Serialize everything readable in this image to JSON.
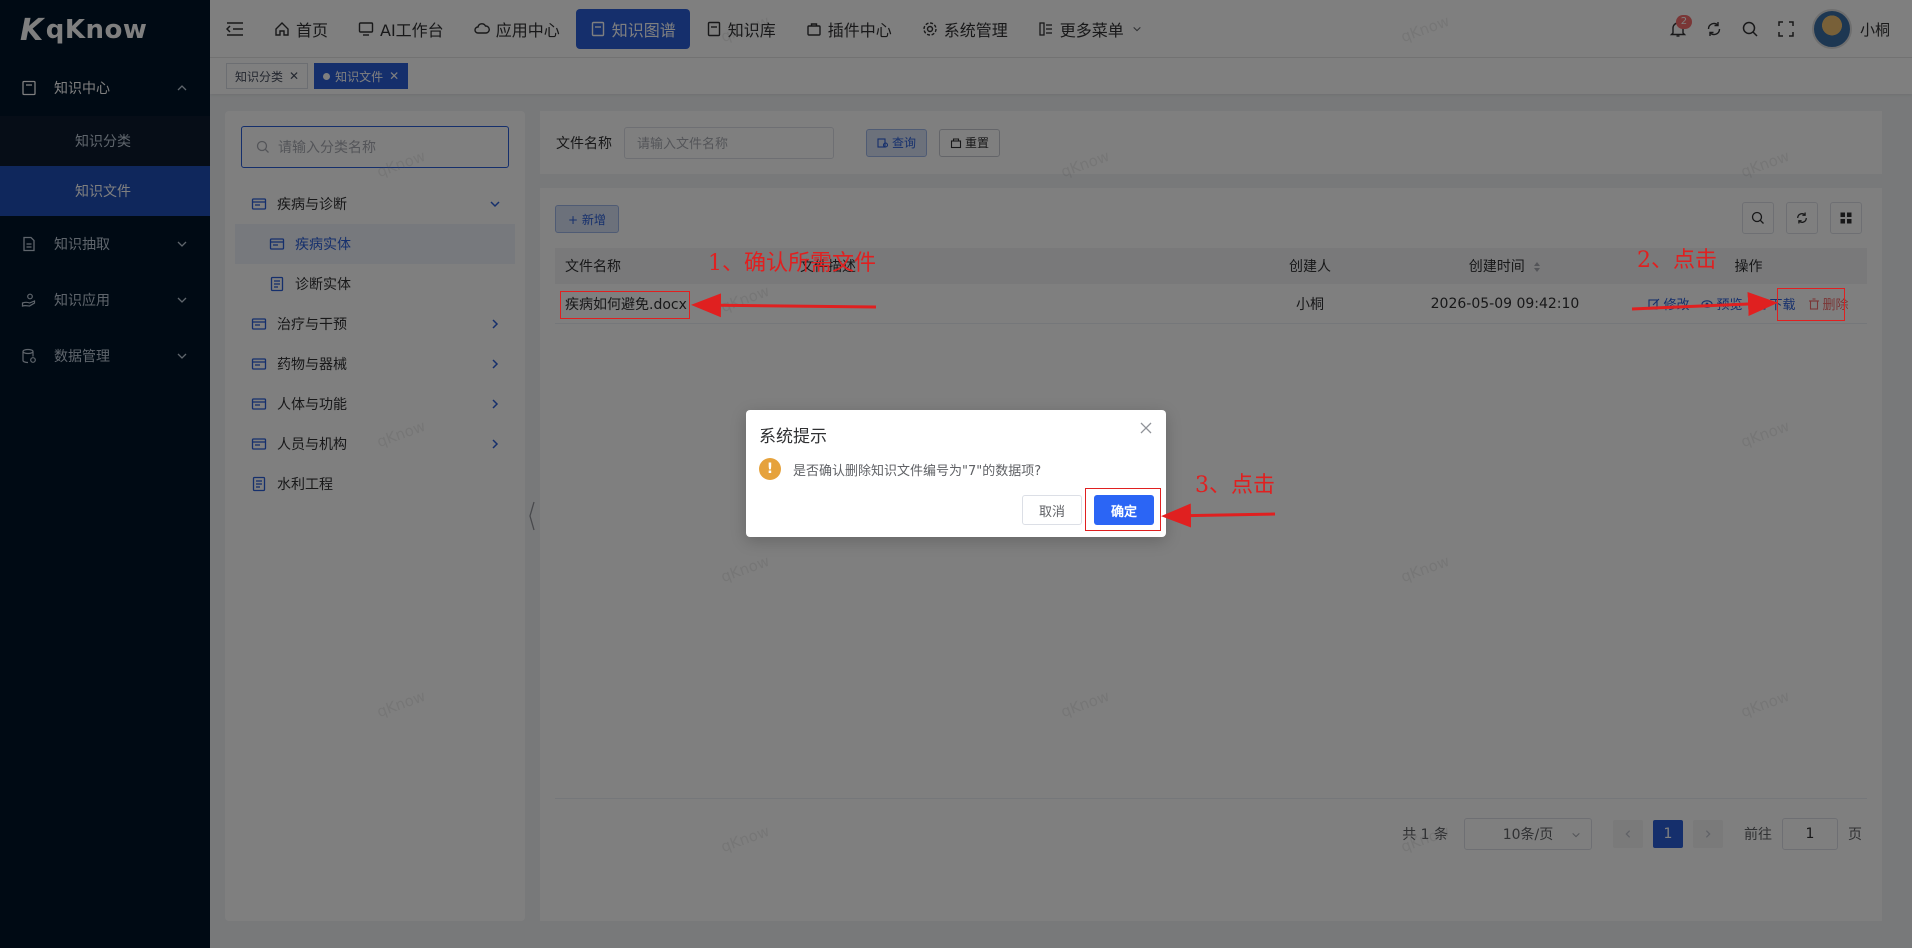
{
  "app": {
    "logo": "qKnow",
    "logo_mark": "K"
  },
  "sidebar": {
    "groups": [
      {
        "label": "知识中心",
        "expanded": true,
        "children": [
          {
            "label": "知识分类",
            "active": false
          },
          {
            "label": "知识文件",
            "active": true
          }
        ]
      },
      {
        "label": "知识抽取",
        "expanded": false
      },
      {
        "label": "知识应用",
        "expanded": false
      },
      {
        "label": "数据管理",
        "expanded": false
      }
    ]
  },
  "topnav": {
    "items": [
      {
        "label": "首页",
        "icon": "home-icon"
      },
      {
        "label": "AI工作台",
        "icon": "monitor-icon"
      },
      {
        "label": "应用中心",
        "icon": "cloud-icon"
      },
      {
        "label": "知识图谱",
        "icon": "document-icon",
        "active": true
      },
      {
        "label": "知识库",
        "icon": "book-icon"
      },
      {
        "label": "插件中心",
        "icon": "plugin-icon"
      },
      {
        "label": "系统管理",
        "icon": "gear-icon"
      },
      {
        "label": "更多菜单",
        "icon": "grid-menu-icon"
      }
    ],
    "notification_count": "2",
    "username": "小桐"
  },
  "tags": [
    {
      "label": "知识分类",
      "active": false
    },
    {
      "label": "知识文件",
      "active": true
    }
  ],
  "tree": {
    "search_placeholder": "请输入分类名称",
    "nodes": [
      {
        "label": "疾病与诊断",
        "expanded": true
      },
      {
        "label": "疾病实体",
        "child": true,
        "selected": true
      },
      {
        "label": "诊断实体",
        "child": true
      },
      {
        "label": "治疗与干预"
      },
      {
        "label": "药物与器械"
      },
      {
        "label": "人体与功能"
      },
      {
        "label": "人员与机构"
      },
      {
        "label": "水利工程"
      }
    ]
  },
  "query": {
    "label": "文件名称",
    "placeholder": "请输入文件名称",
    "search_label": "查询",
    "reset_label": "重置"
  },
  "table": {
    "add_label": "+ 新增",
    "headers": [
      "文件名称",
      "文件描述",
      "创建人",
      "创建时间",
      "操作"
    ],
    "rows": [
      {
        "name": "疾病如何避免.docx",
        "description": "",
        "creator": "小桐",
        "created_at": "2026-05-09 09:42:10",
        "actions": [
          "修改",
          "预览",
          "下载",
          "删除"
        ]
      }
    ]
  },
  "pagination": {
    "total": "共 1 条",
    "page_size": "10条/页",
    "current": "1",
    "goto_label": "前往",
    "goto_value": "1",
    "page_suffix": "页"
  },
  "dialog": {
    "title": "系统提示",
    "message": "是否确认删除知识文件编号为\"7\"的数据项?",
    "cancel": "取消",
    "confirm": "确定"
  },
  "annotations": {
    "step1": "1、确认所需文件",
    "step2": "2、点击",
    "step3": "3、点击"
  },
  "watermark": "qKnow",
  "colors": {
    "primary": "#2b5fd9",
    "sidebar": "#001529",
    "danger": "#f56c6c",
    "warning": "#e6a23c",
    "annotation": "#e02020"
  }
}
